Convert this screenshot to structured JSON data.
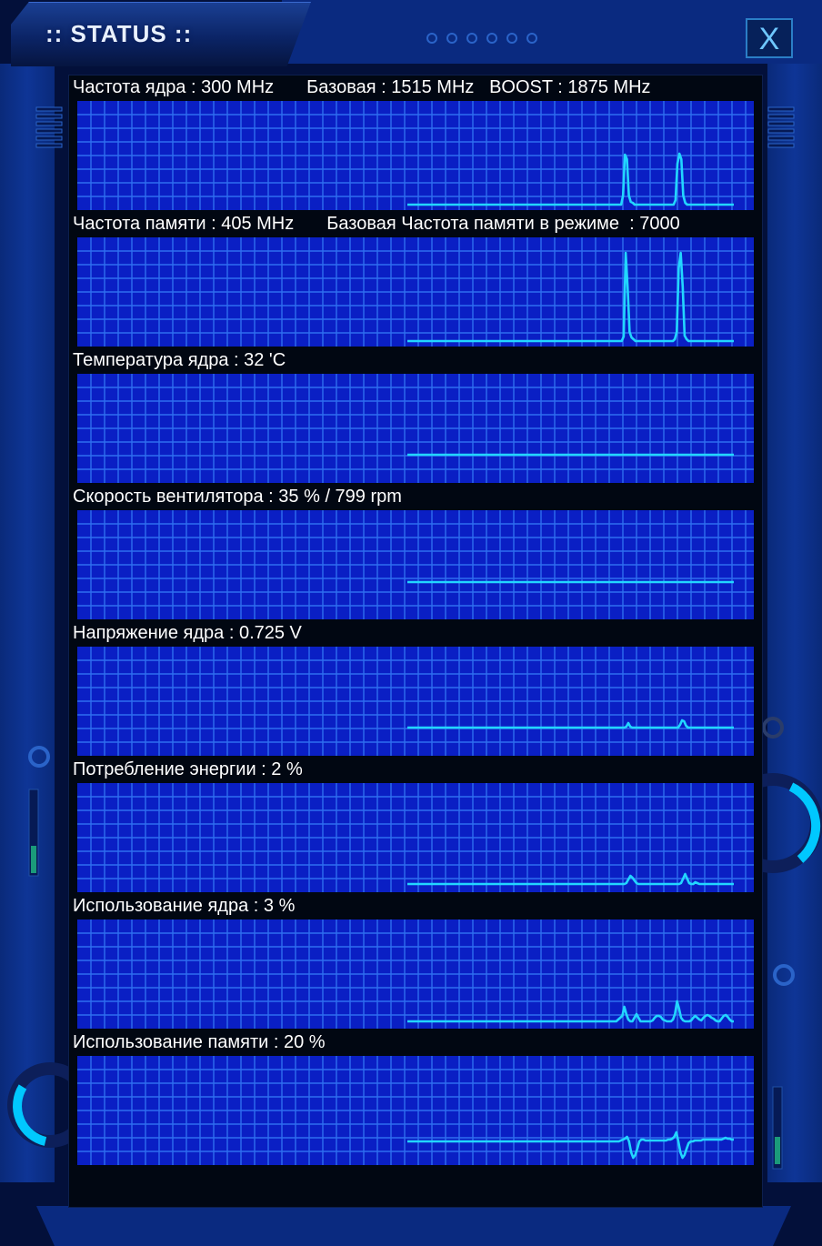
{
  "window": {
    "title": ":: STATUS ::",
    "close_label": "X"
  },
  "colors": {
    "grid_background": "#0a1fc4",
    "grid_lines": "#2e6ff0",
    "trace": "#22d6ff",
    "label_text": "#ffffff",
    "panel_background": "#010712"
  },
  "metrics": [
    {
      "label": "Частота ядра : 300 MHz",
      "extra": "Базовая : 1515 MHz   BOOST : 1875 MHz",
      "trace": [
        0,
        0,
        0,
        0,
        0,
        0,
        0,
        0,
        0,
        0,
        0,
        0,
        0,
        0,
        0,
        0,
        0,
        0,
        0,
        0,
        0,
        0,
        0,
        0,
        0,
        0,
        0,
        0,
        0,
        0,
        0,
        0,
        0,
        0,
        0,
        0,
        0,
        0,
        0,
        0,
        0,
        0,
        0,
        0,
        0,
        0,
        0,
        0,
        0,
        0,
        0,
        0,
        0,
        0,
        0,
        0,
        0,
        0,
        0,
        0,
        0,
        0,
        0,
        0,
        0,
        0,
        0,
        0,
        0,
        0,
        0,
        0,
        0,
        0,
        0,
        0,
        0,
        0,
        0,
        0,
        0,
        0,
        0,
        0,
        0,
        0,
        0,
        0,
        0,
        0,
        0,
        0,
        0,
        0,
        0,
        0,
        0,
        0,
        0,
        0,
        0,
        0,
        0,
        0,
        0,
        0,
        0,
        0,
        0,
        0,
        0,
        0.1,
        0.55,
        0.5,
        0.1,
        0.03,
        0.02,
        0,
        0,
        0,
        0,
        0,
        0,
        0,
        0,
        0,
        0,
        0,
        0,
        0,
        0,
        0,
        0,
        0,
        0,
        0,
        0,
        0,
        0.05,
        0.45,
        0.56,
        0.5,
        0.1,
        0.02,
        0,
        0,
        0,
        0,
        0,
        0,
        0,
        0,
        0,
        0,
        0,
        0,
        0,
        0,
        0,
        0,
        0,
        0,
        0,
        0,
        0,
        0,
        0,
        0,
        0
      ]
    },
    {
      "label": "Частота памяти : 405 MHz",
      "extra": "Базовая Частота памяти в режиме  : 7000",
      "trace": [
        0,
        0,
        0,
        0,
        0,
        0,
        0,
        0,
        0,
        0,
        0,
        0,
        0,
        0,
        0,
        0,
        0,
        0,
        0,
        0,
        0,
        0,
        0,
        0,
        0,
        0,
        0,
        0,
        0,
        0,
        0,
        0,
        0,
        0,
        0,
        0,
        0,
        0,
        0,
        0,
        0,
        0,
        0,
        0,
        0,
        0,
        0,
        0,
        0,
        0,
        0,
        0,
        0,
        0,
        0,
        0,
        0,
        0,
        0,
        0,
        0,
        0,
        0,
        0,
        0,
        0,
        0,
        0,
        0,
        0,
        0,
        0,
        0,
        0,
        0,
        0,
        0,
        0,
        0,
        0,
        0,
        0,
        0,
        0,
        0,
        0,
        0,
        0,
        0,
        0,
        0,
        0,
        0,
        0,
        0,
        0,
        0,
        0,
        0,
        0,
        0,
        0,
        0,
        0,
        0,
        0,
        0,
        0,
        0,
        0,
        0.05,
        0.97,
        0.6,
        0.1,
        0.04,
        0.02,
        0,
        0,
        0,
        0,
        0,
        0,
        0,
        0,
        0,
        0,
        0,
        0,
        0,
        0,
        0,
        0,
        0,
        0,
        0,
        0,
        0.02,
        0.1,
        0.8,
        0.97,
        0.6,
        0.06,
        0.02,
        0,
        0,
        0,
        0,
        0,
        0,
        0,
        0,
        0,
        0,
        0,
        0,
        0,
        0,
        0,
        0,
        0,
        0,
        0,
        0,
        0,
        0,
        0,
        0
      ]
    },
    {
      "label": "Температура ядра : 32 'C",
      "extra": "",
      "trace": [
        0.25,
        0.25,
        0.25,
        0.25,
        0.25,
        0.25,
        0.25,
        0.25,
        0.25,
        0.25,
        0.25,
        0.25,
        0.25,
        0.25,
        0.25,
        0.25,
        0.25,
        0.25,
        0.25,
        0.25,
        0.25,
        0.25,
        0.25,
        0.25,
        0.25,
        0.25,
        0.25,
        0.25,
        0.25,
        0.25,
        0.25,
        0.25,
        0.25,
        0.25,
        0.25,
        0.25,
        0.25,
        0.25,
        0.25,
        0.25,
        0.25,
        0.25,
        0.25,
        0.25,
        0.25,
        0.25,
        0.25,
        0.25,
        0.25,
        0.25,
        0.25,
        0.25,
        0.25,
        0.25,
        0.25,
        0.25,
        0.25,
        0.25,
        0.25,
        0.25
      ]
    },
    {
      "label": "Скорость вентилятора : 35 % / 799 rpm",
      "extra": "",
      "trace": [
        0.35,
        0.35,
        0.35,
        0.35,
        0.35,
        0.35,
        0.35,
        0.35,
        0.35,
        0.35,
        0.35,
        0.35,
        0.35,
        0.35,
        0.35,
        0.35,
        0.35,
        0.35,
        0.35,
        0.35,
        0.35,
        0.35,
        0.35,
        0.35,
        0.35,
        0.35,
        0.35,
        0.35,
        0.35,
        0.35,
        0.35,
        0.35,
        0.35,
        0.35,
        0.35,
        0.35,
        0.35,
        0.35,
        0.35,
        0.35,
        0.35,
        0.35,
        0.35,
        0.35,
        0.35,
        0.35,
        0.35,
        0.35,
        0.35,
        0.35,
        0.35,
        0.35,
        0.35,
        0.35,
        0.35,
        0.35,
        0.35,
        0.35,
        0.35,
        0.35
      ]
    },
    {
      "label": "Напряжение ядра : 0.725 V",
      "extra": "",
      "trace": [
        0.25,
        0.25,
        0.25,
        0.25,
        0.25,
        0.25,
        0.25,
        0.25,
        0.25,
        0.25,
        0.25,
        0.25,
        0.25,
        0.25,
        0.25,
        0.25,
        0.25,
        0.25,
        0.25,
        0.25,
        0.25,
        0.25,
        0.25,
        0.25,
        0.25,
        0.25,
        0.25,
        0.25,
        0.25,
        0.25,
        0.25,
        0.25,
        0.25,
        0.25,
        0.25,
        0.25,
        0.25,
        0.25,
        0.25,
        0.25,
        0.25,
        0.25,
        0.25,
        0.25,
        0.25,
        0.25,
        0.25,
        0.25,
        0.25,
        0.25,
        0.25,
        0.25,
        0.25,
        0.25,
        0.25,
        0.25,
        0.25,
        0.25,
        0.25,
        0.25,
        0.25,
        0.25,
        0.25,
        0.25,
        0.25,
        0.25,
        0.25,
        0.25,
        0.25,
        0.25,
        0.25,
        0.25,
        0.25,
        0.25,
        0.25,
        0.25,
        0.25,
        0.25,
        0.25,
        0.25,
        0.25,
        0.25,
        0.25,
        0.25,
        0.25,
        0.25,
        0.25,
        0.25,
        0.25,
        0.25,
        0.25,
        0.25,
        0.25,
        0.25,
        0.25,
        0.25,
        0.25,
        0.25,
        0.25,
        0.25,
        0.25,
        0.25,
        0.25,
        0.25,
        0.25,
        0.25,
        0.25,
        0.25,
        0.25,
        0.25,
        0.26,
        0.3,
        0.26,
        0.25,
        0.25,
        0.25,
        0.25,
        0.25,
        0.25,
        0.25,
        0.25,
        0.25,
        0.25,
        0.25,
        0.25,
        0.25,
        0.25,
        0.25,
        0.25,
        0.25,
        0.25,
        0.25,
        0.25,
        0.25,
        0.25,
        0.25,
        0.25,
        0.28,
        0.33,
        0.32,
        0.27,
        0.25,
        0.25,
        0.25,
        0.25,
        0.25,
        0.25,
        0.25,
        0.25,
        0.25,
        0.25,
        0.25,
        0.25,
        0.25,
        0.25,
        0.25,
        0.25,
        0.25,
        0.25,
        0.25,
        0.25,
        0.25,
        0.25,
        0.25,
        0.25
      ]
    },
    {
      "label": "Потребление энергии : 2 %",
      "extra": "",
      "trace": [
        0.03,
        0.03,
        0.03,
        0.03,
        0.03,
        0.03,
        0.03,
        0.03,
        0.03,
        0.03,
        0.03,
        0.03,
        0.03,
        0.03,
        0.03,
        0.03,
        0.03,
        0.03,
        0.03,
        0.03,
        0.03,
        0.03,
        0.03,
        0.03,
        0.03,
        0.03,
        0.03,
        0.03,
        0.03,
        0.03,
        0.03,
        0.03,
        0.03,
        0.03,
        0.03,
        0.03,
        0.03,
        0.03,
        0.03,
        0.03,
        0.03,
        0.03,
        0.03,
        0.03,
        0.03,
        0.03,
        0.03,
        0.03,
        0.03,
        0.03,
        0.03,
        0.03,
        0.03,
        0.03,
        0.03,
        0.03,
        0.03,
        0.03,
        0.03,
        0.03,
        0.03,
        0.03,
        0.03,
        0.03,
        0.03,
        0.03,
        0.03,
        0.03,
        0.03,
        0.03,
        0.03,
        0.03,
        0.03,
        0.03,
        0.03,
        0.03,
        0.03,
        0.03,
        0.03,
        0.03,
        0.03,
        0.03,
        0.03,
        0.03,
        0.03,
        0.03,
        0.03,
        0.03,
        0.03,
        0.03,
        0.03,
        0.03,
        0.03,
        0.03,
        0.03,
        0.03,
        0.03,
        0.03,
        0.03,
        0.03,
        0.03,
        0.03,
        0.03,
        0.03,
        0.03,
        0.03,
        0.03,
        0.03,
        0.04,
        0.08,
        0.12,
        0.1,
        0.07,
        0.04,
        0.03,
        0.03,
        0.03,
        0.03,
        0.03,
        0.03,
        0.03,
        0.03,
        0.03,
        0.03,
        0.03,
        0.03,
        0.03,
        0.03,
        0.03,
        0.03,
        0.03,
        0.03,
        0.03,
        0.03,
        0.03,
        0.04,
        0.09,
        0.14,
        0.09,
        0.04,
        0.03,
        0.03,
        0.05,
        0.04,
        0.03,
        0.03,
        0.03,
        0.03,
        0.03,
        0.03,
        0.03,
        0.03,
        0.03,
        0.03,
        0.03,
        0.03,
        0.03,
        0.03,
        0.03,
        0.03,
        0.03,
        0.03
      ]
    },
    {
      "label": "Использование ядра : 3 %",
      "extra": "",
      "trace": [
        0.02,
        0.02,
        0.02,
        0.02,
        0.02,
        0.02,
        0.02,
        0.02,
        0.02,
        0.02,
        0.02,
        0.02,
        0.02,
        0.02,
        0.02,
        0.02,
        0.02,
        0.02,
        0.02,
        0.02,
        0.02,
        0.02,
        0.02,
        0.02,
        0.02,
        0.02,
        0.02,
        0.02,
        0.02,
        0.02,
        0.02,
        0.02,
        0.02,
        0.02,
        0.02,
        0.02,
        0.02,
        0.02,
        0.02,
        0.02,
        0.02,
        0.02,
        0.02,
        0.02,
        0.02,
        0.02,
        0.02,
        0.02,
        0.02,
        0.02,
        0.02,
        0.02,
        0.02,
        0.02,
        0.02,
        0.02,
        0.02,
        0.02,
        0.02,
        0.02,
        0.02,
        0.02,
        0.02,
        0.02,
        0.02,
        0.02,
        0.02,
        0.02,
        0.02,
        0.02,
        0.02,
        0.02,
        0.02,
        0.02,
        0.02,
        0.02,
        0.02,
        0.02,
        0.02,
        0.02,
        0.02,
        0.02,
        0.02,
        0.02,
        0.02,
        0.02,
        0.02,
        0.02,
        0.02,
        0.02,
        0.02,
        0.02,
        0.02,
        0.02,
        0.02,
        0.02,
        0.02,
        0.02,
        0.02,
        0.02,
        0.02,
        0.02,
        0.02,
        0.02,
        0.04,
        0.06,
        0.08,
        0.18,
        0.1,
        0.04,
        0.02,
        0.02,
        0.06,
        0.1,
        0.06,
        0.02,
        0.02,
        0.02,
        0.02,
        0.02,
        0.02,
        0.03,
        0.06,
        0.08,
        0.08,
        0.07,
        0.04,
        0.03,
        0.02,
        0.02,
        0.02,
        0.04,
        0.1,
        0.24,
        0.16,
        0.06,
        0.03,
        0.02,
        0.02,
        0.02,
        0.03,
        0.06,
        0.08,
        0.06,
        0.04,
        0.03,
        0.06,
        0.08,
        0.09,
        0.08,
        0.06,
        0.05,
        0.03,
        0.02,
        0.02,
        0.05,
        0.08,
        0.09,
        0.07,
        0.04,
        0.02,
        0.02
      ]
    },
    {
      "label": "Использование памяти : 20 %",
      "extra": "",
      "trace": [
        0.2,
        0.2,
        0.2,
        0.2,
        0.2,
        0.2,
        0.2,
        0.2,
        0.2,
        0.2,
        0.2,
        0.2,
        0.2,
        0.2,
        0.2,
        0.2,
        0.2,
        0.2,
        0.2,
        0.2,
        0.2,
        0.2,
        0.2,
        0.2,
        0.2,
        0.2,
        0.2,
        0.2,
        0.2,
        0.2,
        0.2,
        0.2,
        0.2,
        0.2,
        0.2,
        0.2,
        0.2,
        0.2,
        0.2,
        0.2,
        0.2,
        0.2,
        0.2,
        0.2,
        0.2,
        0.2,
        0.2,
        0.2,
        0.2,
        0.2,
        0.2,
        0.2,
        0.2,
        0.2,
        0.2,
        0.2,
        0.2,
        0.2,
        0.2,
        0.2,
        0.2,
        0.2,
        0.2,
        0.2,
        0.2,
        0.2,
        0.2,
        0.2,
        0.2,
        0.2,
        0.2,
        0.2,
        0.2,
        0.2,
        0.2,
        0.2,
        0.2,
        0.2,
        0.2,
        0.2,
        0.2,
        0.2,
        0.2,
        0.2,
        0.2,
        0.2,
        0.2,
        0.2,
        0.2,
        0.2,
        0.2,
        0.2,
        0.2,
        0.2,
        0.2,
        0.2,
        0.2,
        0.2,
        0.2,
        0.2,
        0.2,
        0.2,
        0.2,
        0.2,
        0.21,
        0.22,
        0.23,
        0.25,
        0.2,
        0.08,
        0.02,
        0.05,
        0.12,
        0.2,
        0.22,
        0.22,
        0.21,
        0.21,
        0.21,
        0.21,
        0.21,
        0.21,
        0.21,
        0.21,
        0.21,
        0.21,
        0.21,
        0.22,
        0.22,
        0.23,
        0.25,
        0.3,
        0.2,
        0.08,
        0.02,
        0.05,
        0.12,
        0.18,
        0.2,
        0.2,
        0.21,
        0.21,
        0.21,
        0.21,
        0.22,
        0.22,
        0.22,
        0.22,
        0.22,
        0.22,
        0.22,
        0.22,
        0.22,
        0.22,
        0.23,
        0.24,
        0.23,
        0.23,
        0.22,
        0.22
      ]
    }
  ]
}
